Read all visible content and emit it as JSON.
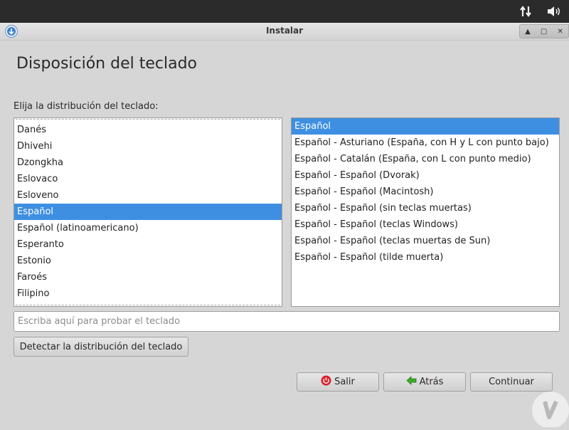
{
  "window": {
    "title": "Instalar"
  },
  "page": {
    "title": "Disposición del teclado",
    "prompt": "Elija la distribución del teclado:"
  },
  "layouts": {
    "items": [
      "Danés",
      "Dhivehi",
      "Dzongkha",
      "Eslovaco",
      "Esloveno",
      "Español",
      "Español (latinoamericano)",
      "Esperanto",
      "Estonio",
      "Faroés",
      "Filipino"
    ],
    "selected": "Español"
  },
  "variants": {
    "items": [
      "Español",
      "Español - Asturiano (España, con H y L con punto bajo)",
      "Español - Catalán (España, con L con punto medio)",
      "Español - Español (Dvorak)",
      "Español - Español (Macintosh)",
      "Español - Español (sin teclas muertas)",
      "Español - Español (teclas Windows)",
      "Español - Español (teclas muertas de Sun)",
      "Español - Español (tilde muerta)"
    ],
    "selected": "Español"
  },
  "test_input": {
    "placeholder": "Escriba aquí para probar el teclado",
    "value": ""
  },
  "buttons": {
    "detect": "Detectar la distribución del teclado",
    "quit": "Salir",
    "back": "Atrás",
    "continue": "Continuar"
  },
  "icons": {
    "network": "network-transfer-icon",
    "volume": "volume-icon",
    "app": "installer-download-icon",
    "quit": "power-icon",
    "back": "arrow-left-icon"
  },
  "colors": {
    "selection": "#3e8fe2",
    "topbar": "#2b2b2b",
    "quit_icon": "#d8202a",
    "back_icon": "#3daa2a"
  }
}
